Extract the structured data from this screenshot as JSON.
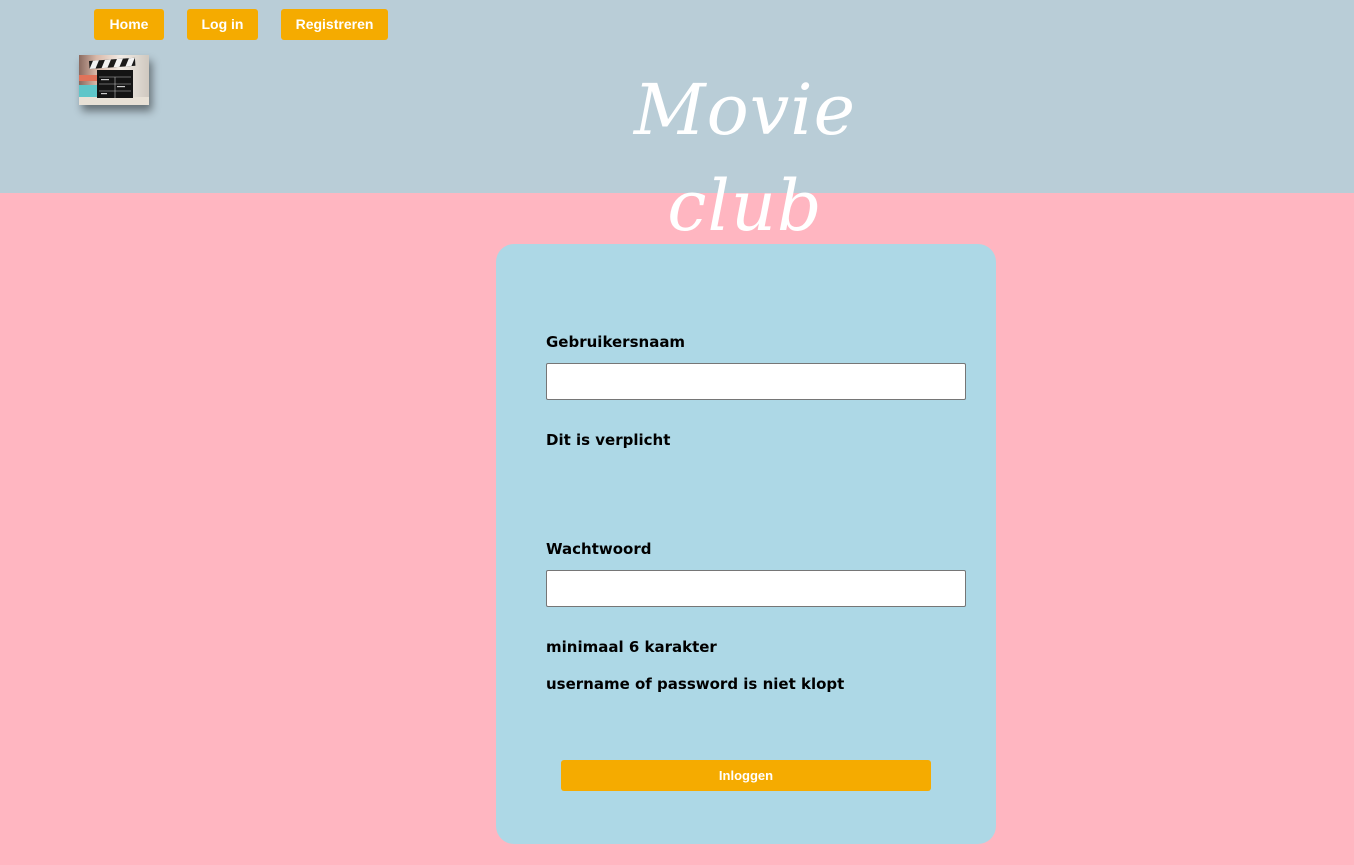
{
  "nav": {
    "home_label": "Home",
    "login_label": "Log in",
    "register_label": "Registreren"
  },
  "header": {
    "title": "Movie club",
    "logo_icon": "clapperboard-icon"
  },
  "login_form": {
    "username_label": "Gebruikersnaam",
    "username_value": "",
    "username_required_msg": "Dit is verplicht",
    "password_label": "Wachtwoord",
    "password_value": "",
    "password_min_msg": "minimaal 6 karakter",
    "credentials_error_msg": "username of password is niet klopt",
    "submit_label": "Inloggen"
  },
  "colors": {
    "header_bg": "#b9cdd7",
    "page_bg": "#ffb6c1",
    "card_bg": "#add8e6",
    "button_bg": "#f5ab00",
    "button_text": "#ffffff"
  }
}
